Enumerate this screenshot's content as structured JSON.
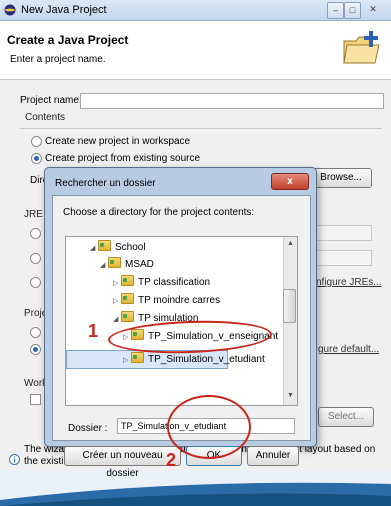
{
  "window": {
    "title": "New Java Project"
  },
  "header": {
    "title": "Create a Java Project",
    "subtitle": "Enter a project name."
  },
  "form": {
    "project_name_label": "Project name:",
    "project_name_value": "",
    "contents_group": "Contents",
    "opt_new": "Create new project in workspace",
    "opt_existing": "Create project from existing source",
    "directory_label": "Dire",
    "browse_label": "Browse...",
    "jre_group": "JRE",
    "configure_jres": "nfigure JREs...",
    "project_group": "Proje",
    "configure_default": "gure default...",
    "working_group": "Work",
    "select_label": "Select...",
    "info_text": "The wizard will automatically configure the JRE and the project layout based on the existing source.",
    "info_text_line2": "existing source."
  },
  "dialog": {
    "title": "Rechercher un dossier",
    "close": "x",
    "description": "Choose a directory for the project contents:",
    "tree": [
      {
        "label": "School"
      },
      {
        "label": "MSAD"
      },
      {
        "label": "TP classification"
      },
      {
        "label": "TP moindre carres"
      },
      {
        "label": "TP simulation"
      },
      {
        "label": "TP_Simulation_v_enseignant"
      },
      {
        "label": "TP_Simulation_v_etudiant"
      }
    ],
    "folder_label": "Dossier :",
    "folder_value": "TP_Simulation_v_etudiant",
    "new_folder": "Créer un nouveau dossier",
    "ok": "OK",
    "cancel": "Annuler"
  },
  "annotations": {
    "one": "1",
    "two": "2"
  },
  "colors": {
    "annotation": "#c8261b",
    "selection": "#d8e6f9"
  }
}
